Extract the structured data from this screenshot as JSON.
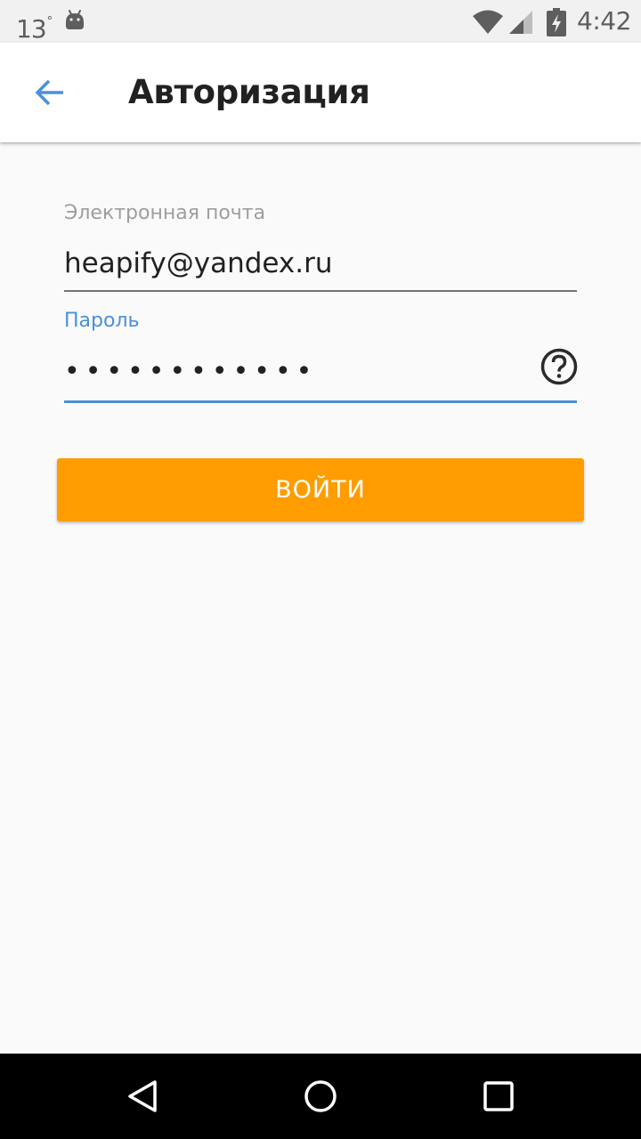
{
  "status_bar": {
    "temperature": "13",
    "degree_symbol": "°",
    "time": "4:42",
    "icons": [
      "android-icon",
      "wifi-icon",
      "signal-icon",
      "battery-charging-icon"
    ]
  },
  "app_bar": {
    "title": "Авторизация",
    "back_icon": "arrow-left-icon"
  },
  "form": {
    "email_label": "Электронная почта",
    "email_value": "heapify@yandex.ru",
    "password_label": "Пароль",
    "password_value": "************",
    "help_icon": "question-circle-icon",
    "login_label": "ВОЙТИ"
  },
  "nav_bar": {
    "icons": [
      "back-triangle-icon",
      "home-circle-icon",
      "recents-square-icon"
    ]
  },
  "colors": {
    "accent_blue": "#4a90d9",
    "button_orange": "#ff9c00",
    "background": "#fafafa"
  }
}
